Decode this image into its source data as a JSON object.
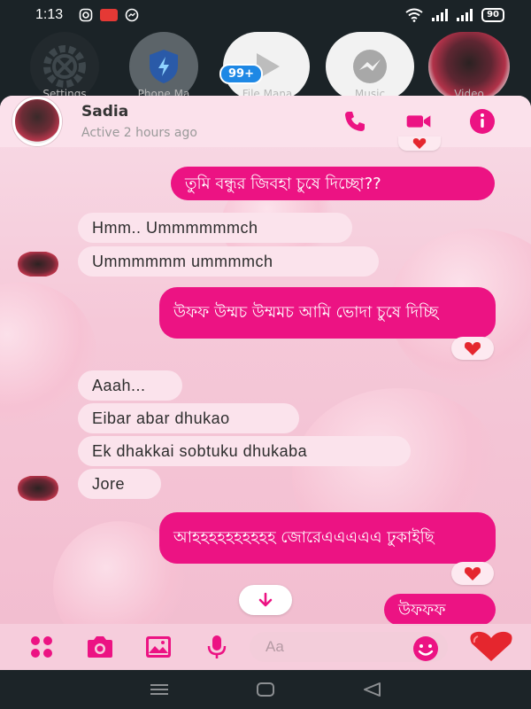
{
  "status_bar": {
    "time": "1:13",
    "battery": "90",
    "icons": [
      "instagram-icon",
      "recorder-icon",
      "messenger-icon",
      "wifi-icon",
      "signal-icon",
      "signal-icon-2",
      "battery-icon"
    ]
  },
  "launcher": {
    "badge": "99+",
    "apps": [
      {
        "label": "Settings",
        "icon": "gear-icon"
      },
      {
        "label": "Phone Ma",
        "icon": "shield-icon"
      },
      {
        "label": "File Mana",
        "icon": "play-icon"
      },
      {
        "label": "Music",
        "icon": "messenger-icon"
      },
      {
        "label": "Video",
        "icon": "avatar-icon"
      }
    ]
  },
  "chat": {
    "header": {
      "name": "Sadia",
      "status": "Active 2 hours ago"
    },
    "messages": [
      {
        "dir": "out",
        "text": "তুমি বন্ধুর জিবহা চুষে দিচ্ছো??"
      },
      {
        "dir": "in",
        "text": "Hmm.. Ummmmmmch"
      },
      {
        "dir": "in",
        "text": "Ummmmmm ummmmch"
      },
      {
        "dir": "out",
        "text": "উফফ উম্মচ উম্মমচ আমি ভোদা চুষে দিচ্ছি"
      },
      {
        "dir": "in",
        "text": "Aaah..."
      },
      {
        "dir": "in",
        "text": "Eibar abar dhukao"
      },
      {
        "dir": "in",
        "text": "Ek dhakkai sobtuku dhukaba"
      },
      {
        "dir": "in",
        "text": "Jore"
      },
      {
        "dir": "out",
        "text": "আহহহহহহহহহহ জোরেএএএএএ ঢুকাইছি"
      },
      {
        "dir": "out",
        "text": "উফফফ"
      }
    ],
    "composer": {
      "placeholder": "Aa"
    }
  },
  "colors": {
    "accent": "#ec1383",
    "incoming_bubble": "#fbe3ec",
    "background": "#f5c8d8"
  }
}
